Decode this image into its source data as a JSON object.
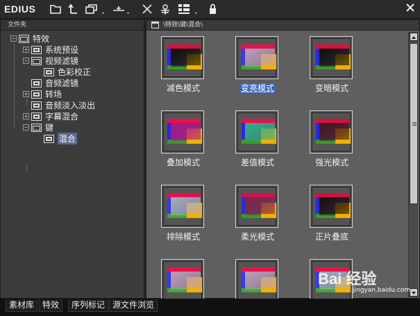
{
  "app": {
    "name": "EDIUS"
  },
  "toolbar": {
    "icons": [
      "new-folder-icon",
      "up-folder-icon",
      "copy-dropdown-icon",
      "layout-dropdown-icon",
      "delete-icon",
      "properties-icon",
      "view-dropdown-icon",
      "lock-icon"
    ],
    "close_glyph": "✕"
  },
  "left_panel": {
    "header": "文件夹",
    "tree": [
      {
        "label": "特效",
        "level": 0,
        "expander": "−"
      },
      {
        "label": "系统预设",
        "level": 1,
        "expander": "+"
      },
      {
        "label": "视频滤镜",
        "level": 1,
        "expander": "−"
      },
      {
        "label": "色彩校正",
        "level": 2,
        "expander": ""
      },
      {
        "label": "音频滤镜",
        "level": 1,
        "expander": ""
      },
      {
        "label": "转场",
        "level": 1,
        "expander": "+"
      },
      {
        "label": "音频淡入淡出",
        "level": 1,
        "expander": ""
      },
      {
        "label": "字幕混合",
        "level": 1,
        "expander": "+"
      },
      {
        "label": "键",
        "level": 1,
        "expander": "−"
      },
      {
        "label": "混合",
        "level": 2,
        "expander": "",
        "selected": true
      }
    ]
  },
  "right_panel": {
    "path": "\\特效\\键\\混合\\",
    "items": [
      {
        "label": "减色模式",
        "variant": "dark"
      },
      {
        "label": "变亮模式",
        "variant": "light",
        "selected": true
      },
      {
        "label": "变暗模式",
        "variant": "dark"
      },
      {
        "label": "叠加模式",
        "variant": "vivid"
      },
      {
        "label": "差值模式",
        "variant": "diff"
      },
      {
        "label": "强光模式",
        "variant": "dark2"
      },
      {
        "label": "排除模式",
        "variant": "excl"
      },
      {
        "label": "柔光模式",
        "variant": "soft"
      },
      {
        "label": "正片叠底",
        "variant": "multiply"
      },
      {
        "label": "",
        "variant": "light"
      },
      {
        "label": "",
        "variant": "light"
      },
      {
        "label": "",
        "variant": "excl"
      }
    ]
  },
  "tabs": [
    {
      "label": "素材库",
      "active": false
    },
    {
      "label": "特效",
      "active": true
    },
    {
      "label": "序列标记",
      "active": false
    },
    {
      "label": "源文件浏览",
      "active": false
    }
  ],
  "watermark": {
    "text": "Bai 经验",
    "sub": "jingyan.baidu.com"
  },
  "colors": {
    "red": "#e0103a",
    "blue": "#2a2ad8",
    "green": "#3aa52a",
    "yellow": "#f0b000",
    "selection": "#3a63b8"
  }
}
